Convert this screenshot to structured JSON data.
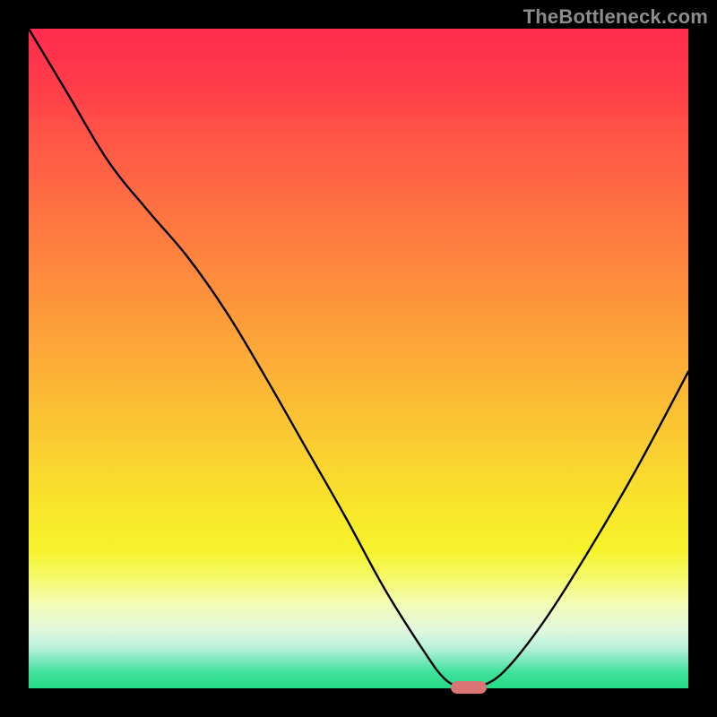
{
  "watermark": "TheBottleneck.com",
  "colors": {
    "curve": "#000000",
    "marker": "#DB7576",
    "frame": "#000000"
  },
  "layout": {
    "image_size": 800,
    "plot_inset": 32
  },
  "chart_data": {
    "type": "line",
    "title": "",
    "xlabel": "",
    "ylabel": "",
    "xlim": [
      0,
      100
    ],
    "ylim": [
      0,
      100
    ],
    "grid": false,
    "legend": false,
    "annotations": [],
    "series": [
      {
        "name": "bottleneck_curve",
        "x": [
          0,
          6,
          12,
          18,
          24,
          30,
          36,
          42,
          48,
          54,
          60,
          63,
          65.5,
          68,
          72,
          78,
          85,
          92,
          100
        ],
        "y": [
          100,
          90,
          80,
          72.5,
          65.5,
          57,
          47,
          36.5,
          26,
          15,
          5.5,
          1.5,
          0.2,
          0.2,
          2.5,
          10,
          21,
          33,
          48
        ]
      }
    ],
    "marker": {
      "x": 66.7,
      "y": 0.2
    }
  }
}
